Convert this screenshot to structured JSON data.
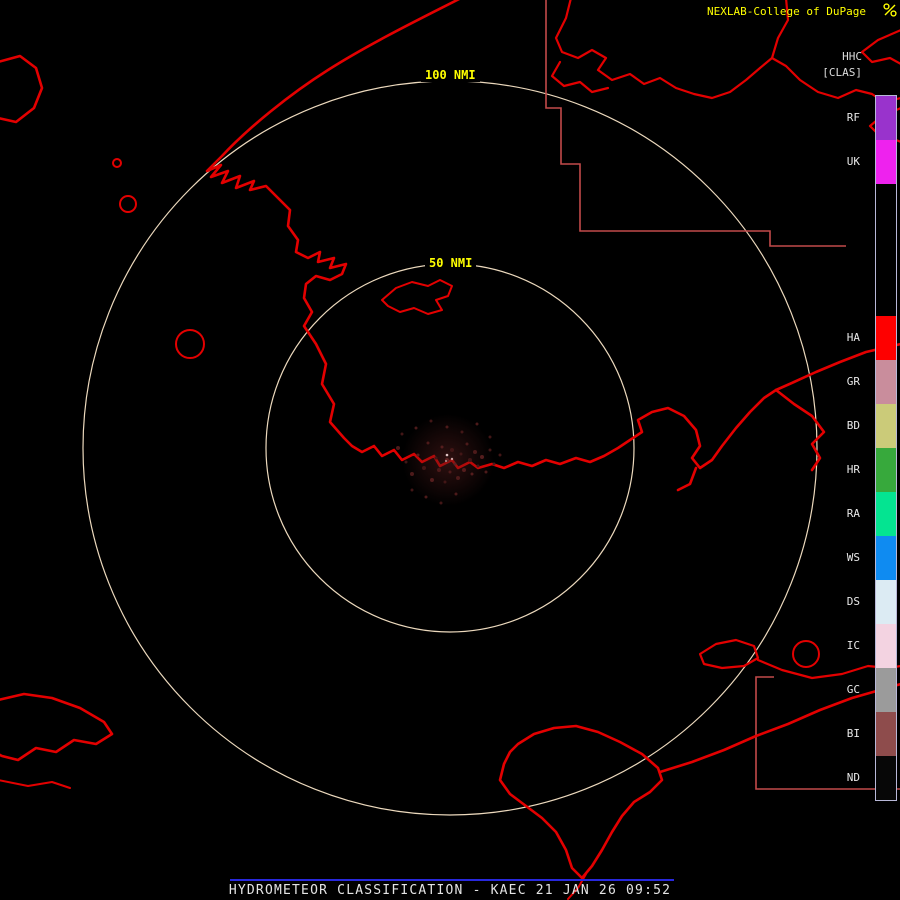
{
  "header": {
    "brand": "NEXLAB-College of DuPage",
    "product_code": "HHC",
    "product_tag": "[CLAS]"
  },
  "range_rings": {
    "outer_label": "100 NMI",
    "inner_label": "50 NMI"
  },
  "legend": {
    "entries": [
      {
        "label": "RF",
        "color": "#9933cc"
      },
      {
        "label": "UK",
        "color": "#ee22ee"
      },
      {
        "label": "",
        "color": "#000000"
      },
      {
        "label": "",
        "color": "#000000"
      },
      {
        "label": "",
        "color": "#000000"
      },
      {
        "label": "HA",
        "color": "#fe0000"
      },
      {
        "label": "GR",
        "color": "#c98d9c"
      },
      {
        "label": "BD",
        "color": "#cbcb79"
      },
      {
        "label": "HR",
        "color": "#37a93c"
      },
      {
        "label": "RA",
        "color": "#04e491"
      },
      {
        "label": "WS",
        "color": "#0f8bf1"
      },
      {
        "label": "DS",
        "color": "#dcebf3"
      },
      {
        "label": "IC",
        "color": "#f3d3e1"
      },
      {
        "label": "GC",
        "color": "#9b9b9b"
      },
      {
        "label": "BI",
        "color": "#8e4c4c"
      },
      {
        "label": "ND",
        "color": "#070707"
      }
    ]
  },
  "footer": {
    "title": "HYDROMETEOR CLASSIFICATION - KAEC 21 JAN 26 09:52"
  },
  "colors": {
    "background": "#000000",
    "coastline": "#e30000",
    "boundary_line": "#c24a4a",
    "range_ring": "#ecd9bd",
    "ring_label": "#ffff00",
    "brand_text": "#ffff00",
    "legend_text": "#e8e8e8",
    "footer_text": "#e4e4e4",
    "footer_line": "#2828dd"
  }
}
